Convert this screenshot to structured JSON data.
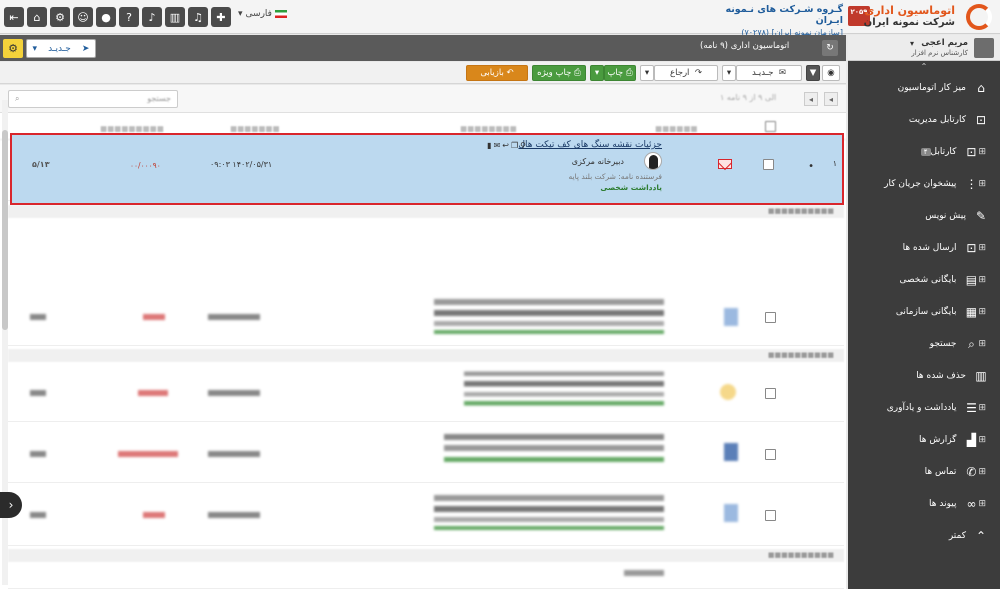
{
  "header": {
    "brand_title": "اتوماسیون اداری",
    "brand_sub": "شرکت نمونه ایران",
    "org_title": "گـروه شـرکت های نـمونه ایـران",
    "org_sub": "(۷۰۲۷۸) [سازمان نمونه ایران]",
    "badge": "۲۰۵۹",
    "language": "فارسی",
    "icons": [
      "exit-icon",
      "org-chart-icon",
      "settings-icon",
      "users-icon",
      "chat-icon",
      "help-icon",
      "mic-icon",
      "chart-icon",
      "bell-icon",
      "puzzle-icon"
    ]
  },
  "user": {
    "name": "مریم اعجی",
    "role": "کارشناس نرم افزار"
  },
  "sidebar": {
    "items": [
      {
        "label": "میز کار اتوماسیون",
        "icon": "home-icon",
        "expandable": false
      },
      {
        "label": "کارتابل مدیریت",
        "icon": "inbox-icon",
        "expandable": false
      },
      {
        "label": "کارتابل",
        "icon": "inbox-icon",
        "expandable": true,
        "count": "۴"
      },
      {
        "label": "پیشخوان جریان کار",
        "icon": "workflow-icon",
        "expandable": true
      },
      {
        "label": "پیش نویس",
        "icon": "pencil-icon",
        "expandable": false
      },
      {
        "label": "ارسال شده ها",
        "icon": "outbox-icon",
        "expandable": true
      },
      {
        "label": "بایگانی شخصی",
        "icon": "archive-icon",
        "expandable": true
      },
      {
        "label": "بایگانی سازمانی",
        "icon": "archive-org-icon",
        "expandable": true
      },
      {
        "label": "جستجو",
        "icon": "search-icon",
        "expandable": true
      },
      {
        "label": "حذف شده ها",
        "icon": "trash-icon",
        "expandable": false
      },
      {
        "label": "یادداشت و یادآوری",
        "icon": "list-icon",
        "expandable": true
      },
      {
        "label": "گزارش ها",
        "icon": "report-icon",
        "expandable": true
      },
      {
        "label": "تماس ها",
        "icon": "phone-icon",
        "expandable": true
      },
      {
        "label": "پیوند ها",
        "icon": "link-icon",
        "expandable": true
      },
      {
        "label": "کمتر",
        "icon": "chevron-up-icon",
        "expandable": false
      }
    ]
  },
  "toolbar": {
    "new_label": "جـدیـد",
    "folder_title": "اتوماسیون اداری (۹ نامه)"
  },
  "actions": {
    "archive": "بازیابی",
    "special_print": "چاپ ویژه",
    "print": "چاپ",
    "refer": "ارجاع",
    "new": "جـدیـد"
  },
  "list": {
    "search_placeholder": "جستجو",
    "pager": "۱ الی ۹ از ۹ نامه",
    "highlighted_row": {
      "number": "۱",
      "subject": "جزئیات نقشه سنگ های کف تیکت هال",
      "sender": "دبیرخانه مرکزی",
      "meta": "فرستنده نامه: شرکت بلند پایه",
      "note": "یادداشت شخصی",
      "date": "۰۹:۰۳ ۱۴۰۲/۰۵/۳۱",
      "amount": "۰۰/۰۰۰۹۰",
      "tag": "۵/۱۳"
    }
  }
}
